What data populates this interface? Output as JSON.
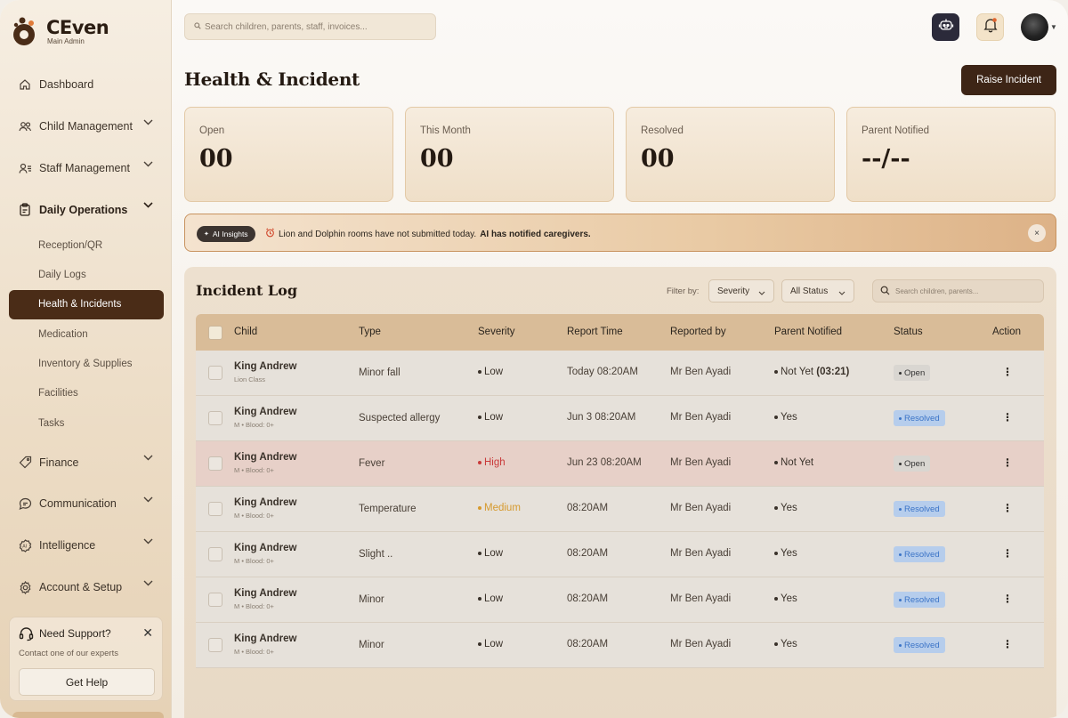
{
  "brand": {
    "name": "CEven",
    "role": "Main Admin"
  },
  "nav": {
    "dashboard": "Dashboard",
    "child_management": "Child Management",
    "staff_management": "Staff Management",
    "daily_operations": "Daily Operations",
    "sub_items": [
      "Reception/QR",
      "Daily Logs",
      "Health & Incidents",
      "Medication",
      "Inventory & Supplies",
      "Facilities",
      "Tasks"
    ],
    "finance": "Finance",
    "communication": "Communication",
    "intelligence": "Intelligence",
    "account_setup": "Account & Setup"
  },
  "support": {
    "title": "Need Support?",
    "subtitle": "Contact one of our experts",
    "button": "Get Help"
  },
  "topbar": {
    "search_placeholder": "Search children, parents, staff, invoices..."
  },
  "page": {
    "title": "Health & Incident",
    "raise_button": "Raise Incident"
  },
  "stats": [
    {
      "label": "Open",
      "value": "00"
    },
    {
      "label": "This Month",
      "value": "00"
    },
    {
      "label": "Resolved",
      "value": "00"
    },
    {
      "label": "Parent Notified",
      "value": "--/--"
    }
  ],
  "insight": {
    "chip": "AI Insights",
    "text": "Lion and Dolphin rooms have not submitted today.",
    "bold": "AI has notified caregivers.",
    "close": "×"
  },
  "log": {
    "title": "Incident Log",
    "filter_label": "Filter by:",
    "severity_select": "Severity",
    "status_select": "All Status",
    "search_placeholder": "Search children, parents...",
    "columns": [
      "Child",
      "Type",
      "Severity",
      "Report Time",
      "Reported by",
      "Parent Notified",
      "Status",
      "Action"
    ],
    "rows": [
      {
        "name": "King Andrew",
        "meta": "Lion Class",
        "type": "Minor fall",
        "severity": "Low",
        "sev_class": "sev-low",
        "time": "Today 08:20AM",
        "reporter": "Mr Ben Ayadi",
        "notified": "Not Yet ",
        "notified_extra": "(03:21)",
        "status": "Open",
        "status_class": "badge-open",
        "highlight": false
      },
      {
        "name": "King Andrew",
        "meta": "M • Blood: 0+",
        "type": "Suspected allergy",
        "severity": "Low",
        "sev_class": "sev-low",
        "time": "Jun 3 08:20AM",
        "reporter": "Mr Ben Ayadi",
        "notified": "Yes",
        "notified_extra": "",
        "status": "Resolved",
        "status_class": "badge-resolved",
        "highlight": false
      },
      {
        "name": "King Andrew",
        "meta": "M • Blood: 0+",
        "type": "Fever",
        "severity": "High",
        "sev_class": "sev-high",
        "time": "Jun 23 08:20AM",
        "reporter": "Mr Ben Ayadi",
        "notified": "Not Yet",
        "notified_extra": "",
        "status": "Open",
        "status_class": "badge-open",
        "highlight": true
      },
      {
        "name": "King Andrew",
        "meta": "M • Blood: 0+",
        "type": "Temperature",
        "severity": "Medium",
        "sev_class": "sev-medium",
        "time": "08:20AM",
        "reporter": "Mr Ben Ayadi",
        "notified": "Yes",
        "notified_extra": "",
        "status": "Resolved",
        "status_class": "badge-resolved",
        "highlight": false
      },
      {
        "name": "King Andrew",
        "meta": "M • Blood: 0+",
        "type": "Slight ..",
        "severity": "Low",
        "sev_class": "sev-low",
        "time": "08:20AM",
        "reporter": "Mr Ben Ayadi",
        "notified": "Yes",
        "notified_extra": "",
        "status": "Resolved",
        "status_class": "badge-resolved",
        "highlight": false
      },
      {
        "name": "King Andrew",
        "meta": "M • Blood: 0+",
        "type": "Minor",
        "severity": "Low",
        "sev_class": "sev-low",
        "time": "08:20AM",
        "reporter": "Mr Ben Ayadi",
        "notified": "Yes",
        "notified_extra": "",
        "status": "Resolved",
        "status_class": "badge-resolved",
        "highlight": false
      },
      {
        "name": "King Andrew",
        "meta": "M • Blood: 0+",
        "type": "Minor",
        "severity": "Low",
        "sev_class": "sev-low",
        "time": "08:20AM",
        "reporter": "Mr Ben Ayadi",
        "notified": "Yes",
        "notified_extra": "",
        "status": "Resolved",
        "status_class": "badge-resolved",
        "highlight": false
      }
    ]
  },
  "colors": {
    "brand_dark": "#3d2516",
    "nav_active": "#4a2c17",
    "resolved_text": "#3b74c7",
    "high": "#c93a3a",
    "medium": "#d69a2e"
  }
}
